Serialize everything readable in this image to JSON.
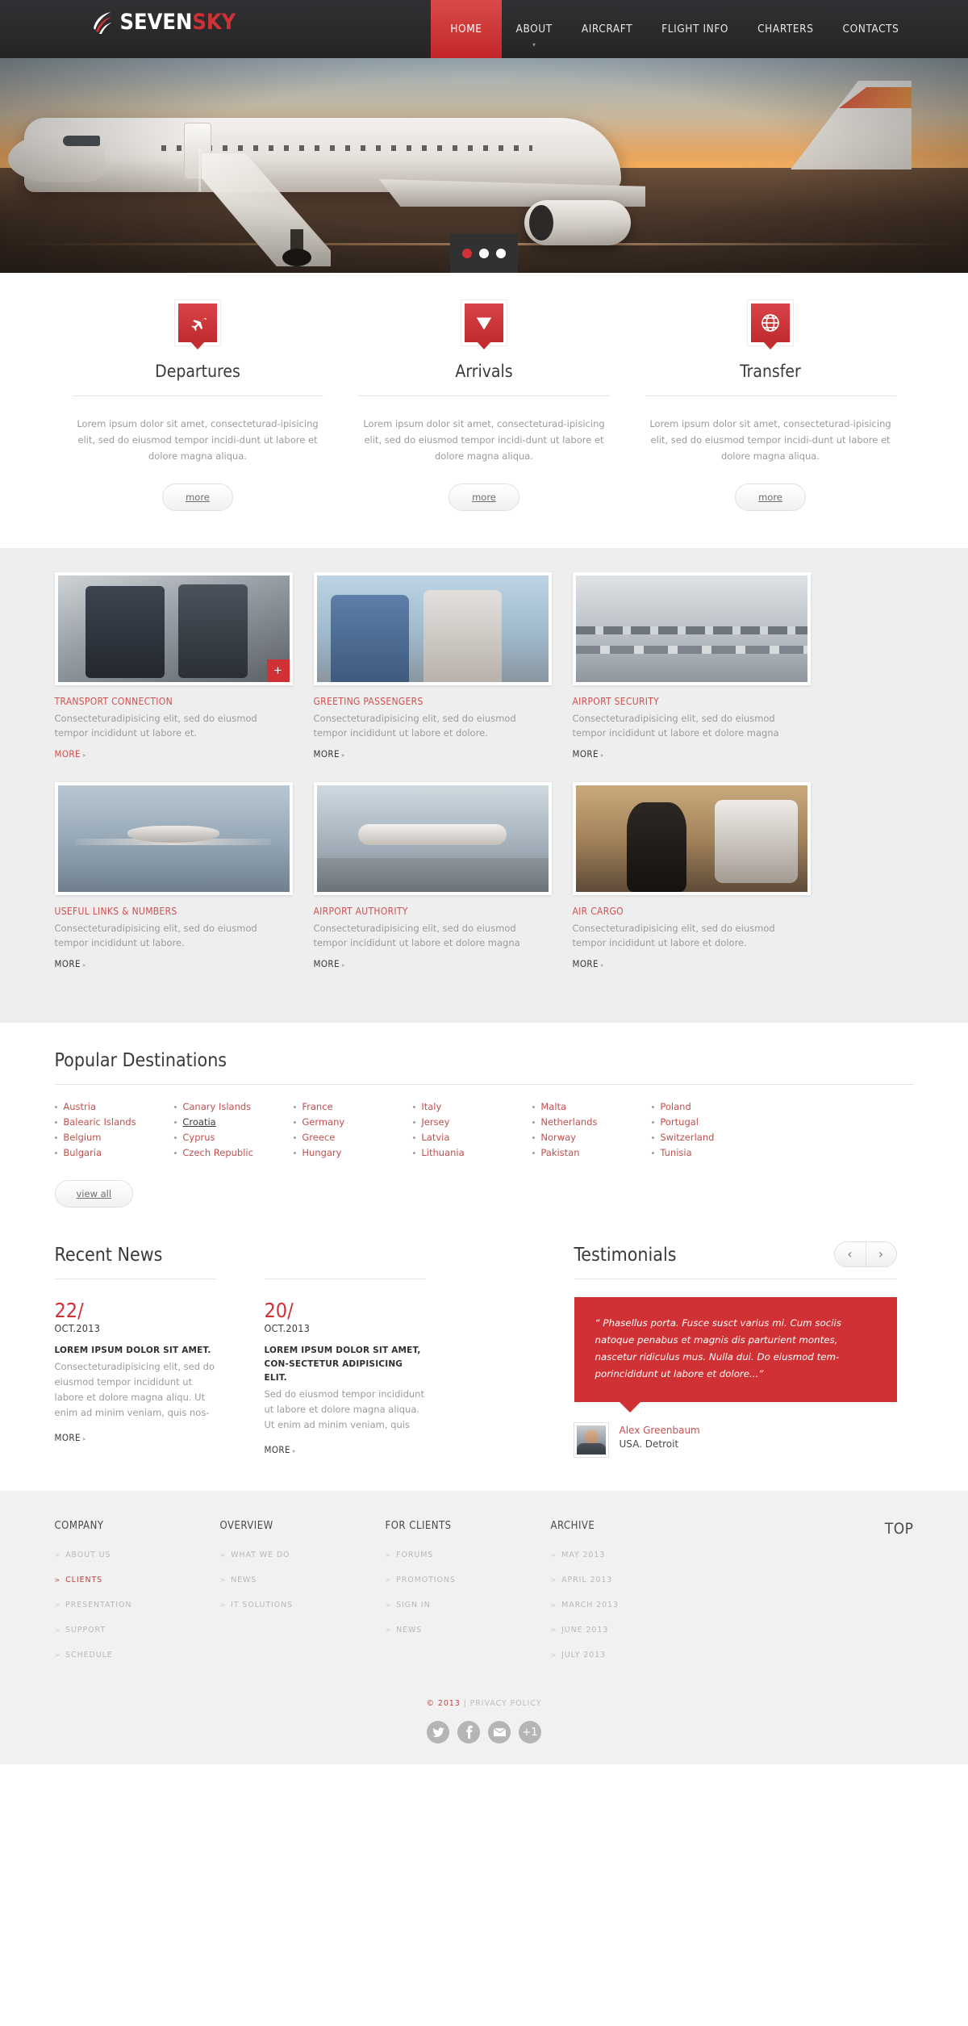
{
  "header": {
    "logo": {
      "first": "SEVEN",
      "second": "SKY",
      "icon": "globe-swoosh-logo-icon"
    },
    "nav": [
      {
        "label": "HOME",
        "active": true,
        "caret": false
      },
      {
        "label": "ABOUT",
        "active": false,
        "caret": true,
        "caret_glyph": "▾"
      },
      {
        "label": "AIRCRAFT",
        "active": false,
        "caret": false
      },
      {
        "label": "FLIGHT INFO",
        "active": false,
        "caret": false
      },
      {
        "label": "CHARTERS",
        "active": false,
        "caret": false
      },
      {
        "label": "CONTACTS",
        "active": false,
        "caret": false
      }
    ]
  },
  "slider": {
    "alt": "Airliner with boarding stairs at sunset",
    "dots": [
      {
        "active": true
      },
      {
        "active": false
      },
      {
        "active": false
      }
    ]
  },
  "services": [
    {
      "icon": "airplane-icon",
      "title": "Departures",
      "text": "Lorem ipsum dolor sit amet, consecteturad-ipisicing elit, sed do eiusmod tempor incidi-dunt ut labore et dolore magna aliqua.",
      "button": "more"
    },
    {
      "icon": "down-triangle-icon",
      "title": "Arrivals",
      "text": "Lorem ipsum dolor sit amet, consecteturad-ipisicing elit, sed do eiusmod tempor incidi-dunt ut labore et dolore magna aliqua.",
      "button": "more"
    },
    {
      "icon": "globe-icon",
      "title": "Transfer",
      "text": "Lorem ipsum dolor sit amet, consecteturad-ipisicing elit, sed do eiusmod tempor incidi-dunt ut labore et dolore magna aliqua.",
      "button": "more"
    }
  ],
  "grid": [
    {
      "title": "TRANSPORT CONNECTION",
      "text": "Consecteturadipisicing elit, sed do eiusmod tempor incididunt ut labore et.",
      "more": "MORE",
      "more_highlight": true,
      "has_plus": true,
      "plus_glyph": "+",
      "image": "travellers-with-luggage-photo"
    },
    {
      "title": "GREETING PASSENGERS",
      "text": "Consecteturadipisicing elit, sed do eiusmod tempor incididunt ut labore et dolore.",
      "more": "MORE",
      "more_highlight": false,
      "has_plus": false,
      "image": "couple-greeting-at-airport-photo"
    },
    {
      "title": "AIRPORT SECURITY",
      "text": "Consecteturadipisicing elit, sed do eiusmod tempor incididunt ut labore et dolore magna",
      "more": "MORE",
      "more_highlight": false,
      "has_plus": false,
      "image": "airport-check-in-desks-photo"
    },
    {
      "title": "USEFUL LINKS & NUMBERS",
      "text": "Consecteturadipisicing elit, sed do eiusmod tempor incididunt ut labore.",
      "more": "MORE",
      "more_highlight": false,
      "has_plus": false,
      "image": "private-jet-in-flight-photo"
    },
    {
      "title": "AIRPORT AUTHORITY",
      "text": "Consecteturadipisicing elit, sed do eiusmod tempor incididunt ut labore et dolore magna",
      "more": "MORE",
      "more_highlight": false,
      "has_plus": false,
      "image": "aircraft-on-tarmac-photo"
    },
    {
      "title": "AIR CARGO",
      "text": "Consecteturadipisicing elit, sed do eiusmod tempor incididunt ut labore et dolore.",
      "more": "MORE",
      "more_highlight": false,
      "has_plus": false,
      "image": "woman-boarding-private-jet-photo"
    }
  ],
  "destinations": {
    "title": "Popular Destinations",
    "view_all": "view all",
    "columns": [
      [
        "Austria",
        "Balearic Islands",
        "Belgium",
        "Bulgaria"
      ],
      [
        "Canary Islands",
        "Croatia",
        "Cyprus",
        "Czech Republic"
      ],
      [
        "France",
        "Germany",
        "Greece",
        "Hungary"
      ],
      [
        "Italy",
        "Jersey",
        "Latvia",
        "Lithuania"
      ],
      [
        "Malta",
        "Netherlands",
        "Norway",
        "Pakistan"
      ],
      [
        "Poland",
        "Portugal",
        "Switzerland",
        "Tunisia"
      ]
    ],
    "hovered": "Croatia"
  },
  "news": {
    "title": "Recent News",
    "items": [
      {
        "day": "22/",
        "month": "OCT.2013",
        "headline": "LOREM IPSUM DOLOR SIT AMET.",
        "body": "Consecteturadipisicing elit, sed do eiusmod tempor incididunt ut labore et dolore magna aliqu. Ut enim ad minim veniam, quis nos-",
        "more": "MORE"
      },
      {
        "day": "20/",
        "month": "OCT.2013",
        "headline": "LOREM IPSUM DOLOR SIT AMET, CON-SECTETUR ADIPISICING ELIT.",
        "body": "Sed do eiusmod tempor incididunt ut labore et dolore magna aliqua. Ut enim ad minim veniam, quis",
        "more": "MORE"
      }
    ]
  },
  "testimonials": {
    "title": "Testimonials",
    "prev": "‹",
    "next": "›",
    "quote": "“ Phasellus porta. Fusce susct varius mi. Cum sociis natoque penabus et magnis dis parturient montes, nascetur ridiculus mus. Nulla dui. Do eiusmod tem-porincididunt ut labore et dolore...”",
    "author_name": "Alex Greenbaum",
    "author_location": "USA. Detroit"
  },
  "footer": {
    "columns": [
      {
        "heading": "COMPANY",
        "links": [
          {
            "label": "ABOUT US",
            "highlight": false
          },
          {
            "label": "CLIENTS",
            "highlight": true
          },
          {
            "label": "PRESENTATION",
            "highlight": false
          },
          {
            "label": "SUPPORT",
            "highlight": false
          },
          {
            "label": "SCHEDULE",
            "highlight": false
          }
        ]
      },
      {
        "heading": "OVERVIEW",
        "links": [
          {
            "label": "WHAT WE DO",
            "highlight": false
          },
          {
            "label": "NEWS",
            "highlight": false
          },
          {
            "label": "IT SOLUTIONS",
            "highlight": false
          }
        ]
      },
      {
        "heading": "FOR CLIENTS",
        "links": [
          {
            "label": "FORUMS",
            "highlight": false
          },
          {
            "label": "PROMOTIONS",
            "highlight": false
          },
          {
            "label": "SIGN IN",
            "highlight": false
          },
          {
            "label": "NEWS",
            "highlight": false
          }
        ]
      },
      {
        "heading": "ARCHIVE",
        "links": [
          {
            "label": "MAY 2013",
            "highlight": false
          },
          {
            "label": "APRIL 2013",
            "highlight": false
          },
          {
            "label": "MARCH 2013",
            "highlight": false
          },
          {
            "label": "JUNE 2013",
            "highlight": false
          },
          {
            "label": "JULY 2013",
            "highlight": false
          }
        ]
      }
    ],
    "top_label": "TOP",
    "copyright_year": "© 2013",
    "copyright_sep": " | PRIVACY POLICY",
    "socials": [
      {
        "name": "twitter-icon",
        "glyph": "t"
      },
      {
        "name": "facebook-icon",
        "glyph": "f"
      },
      {
        "name": "email-icon",
        "glyph": "✉"
      },
      {
        "name": "google-plus-one-icon",
        "glyph": "+1"
      }
    ]
  },
  "colors": {
    "accent": "#cf3134",
    "header_bg": "#2b2b2d",
    "grid_bg": "#eeeeee",
    "footer_bg": "#f1f1f1",
    "link_red": "#c0504e"
  }
}
